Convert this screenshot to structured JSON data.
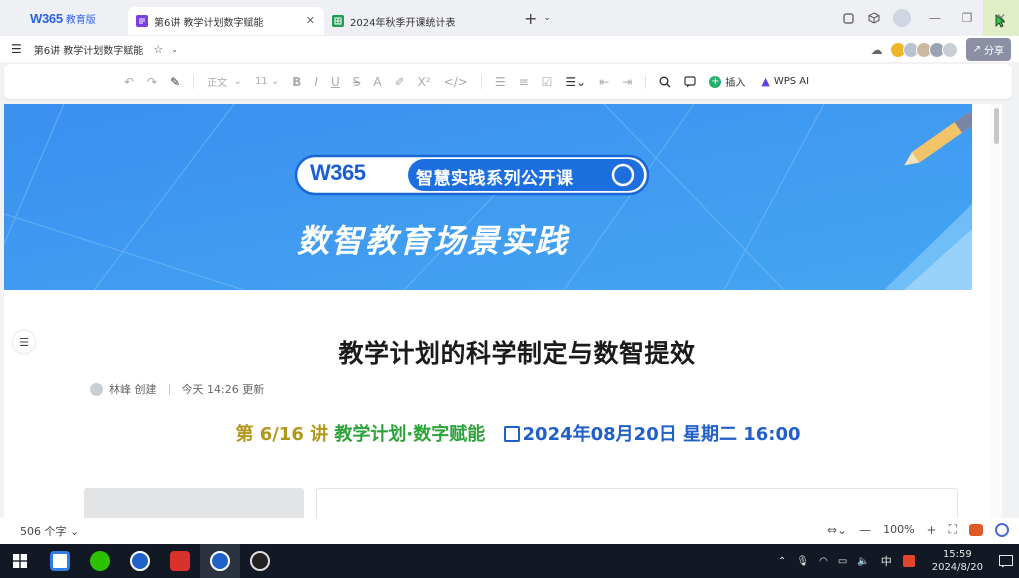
{
  "brand": {
    "logo": "W365",
    "edition": "教育版"
  },
  "tabs": [
    {
      "label": "第6讲 教学计划数字赋能",
      "active": true,
      "icon": "doc-icon",
      "icon_color": "#7b3fe4"
    },
    {
      "label": "2024年秋季开课统计表",
      "active": false,
      "icon": "sheet-icon",
      "icon_color": "#1f9d55"
    }
  ],
  "doc_header": {
    "title": "第6讲 教学计划数字赋能",
    "share_label": "分享"
  },
  "toolbar": {
    "style_value": "正文",
    "font_size": "11",
    "insert_label": "插入",
    "ai_label": "WPS AI"
  },
  "banner": {
    "logo_text": "W365",
    "series_title": "智慧实践系列公开课",
    "main_title": "数智教育场景实践",
    "bg_color": "#3a97ee"
  },
  "document": {
    "title": "教学计划的科学制定与数智提效",
    "author": "林峰 创建",
    "updated": "今天 14:26 更新",
    "subtitle_part1": "第 6/16 讲",
    "subtitle_part2": "教学计划·数字赋能",
    "subtitle_part3": "2024年08月20日 星期二 16:00"
  },
  "status": {
    "word_count": "506 个字",
    "zoom": "100%"
  },
  "taskbar": {
    "ime": "中",
    "time": "15:59",
    "date": "2024/8/20"
  }
}
